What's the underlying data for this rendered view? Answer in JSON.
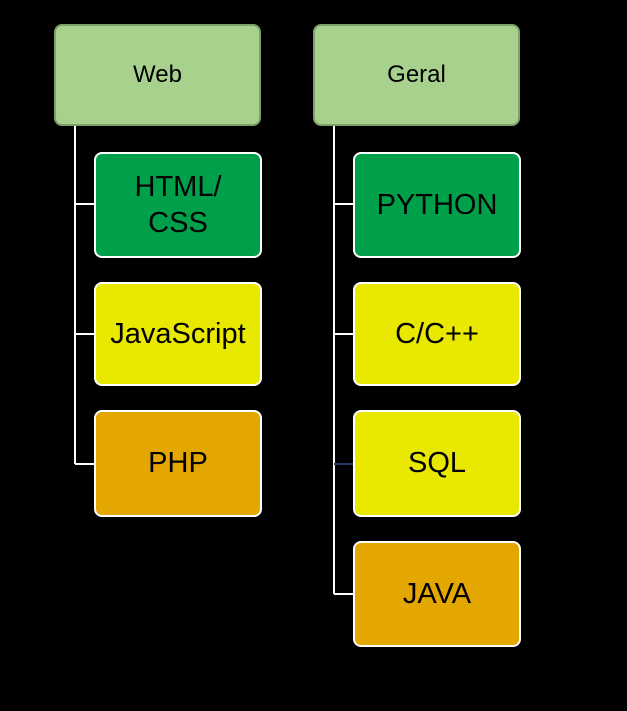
{
  "colors": {
    "background": "#000000",
    "root_fill": "#a9d18e",
    "green": "#00a04b",
    "yellow": "#e8e800",
    "orange": "#e4a600",
    "connector": "#ffffff"
  },
  "groups": [
    {
      "title": "Web",
      "items": [
        {
          "label": "HTML/\nCSS",
          "color": "#00a04b"
        },
        {
          "label": "JavaScript",
          "color": "#e8e800"
        },
        {
          "label": "PHP",
          "color": "#e4a600"
        }
      ]
    },
    {
      "title": "Geral",
      "items": [
        {
          "label": "PYTHON",
          "color": "#00a04b"
        },
        {
          "label": "C/C++",
          "color": "#e8e800"
        },
        {
          "label": "SQL",
          "color": "#e8e800"
        },
        {
          "label": "JAVA",
          "color": "#e4a600"
        }
      ]
    }
  ]
}
